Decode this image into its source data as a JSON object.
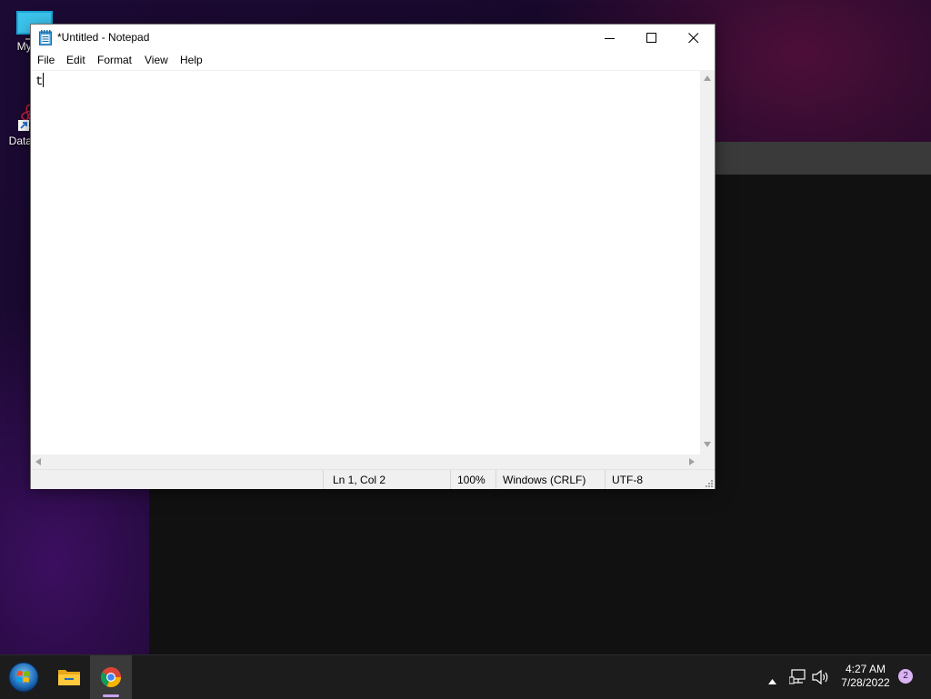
{
  "desktop": {
    "icons": [
      {
        "label": "My Co",
        "icon": "computer-icon"
      },
      {
        "label": "DataW",
        "icon": "datawarehouse-shortcut-icon"
      }
    ]
  },
  "notepad": {
    "title": "*Untitled - Notepad",
    "menu": {
      "file": "File",
      "edit": "Edit",
      "format": "Format",
      "view": "View",
      "help": "Help"
    },
    "content": "t",
    "status": {
      "position": "Ln 1, Col 2",
      "zoom": "100%",
      "line_endings": "Windows (CRLF)",
      "encoding": "UTF-8"
    }
  },
  "taskbar": {
    "apps": [
      "start-icon",
      "file-explorer-icon",
      "chrome-icon"
    ],
    "clock": {
      "time": "4:27 AM",
      "date": "7/28/2022"
    },
    "notification_count": "2"
  },
  "colors": {
    "accent": "#c8a2f0",
    "taskbar_bg": "#1c1c1c",
    "notepad_icon": "#2b8fd6"
  }
}
